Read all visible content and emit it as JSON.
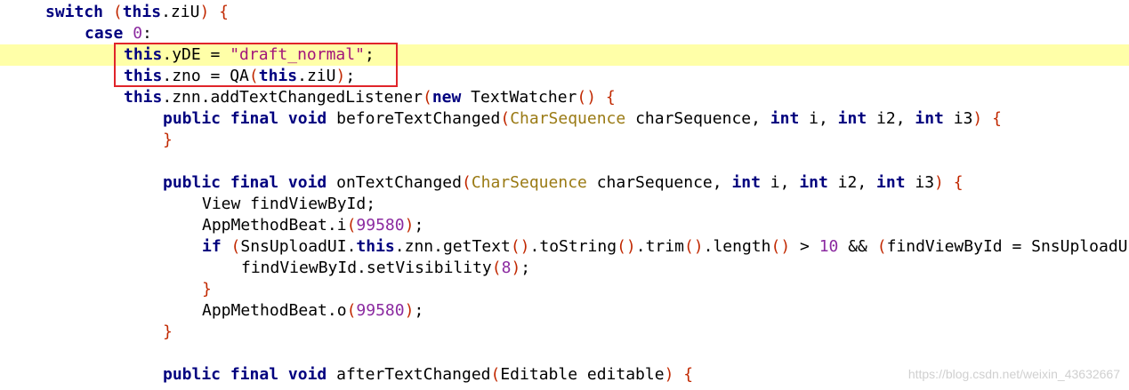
{
  "editor": {
    "current_line": 3,
    "colors": {
      "background": "#ffffff",
      "current_line_background": "#ffffa8",
      "keyword": "#00007f",
      "string": "#a3157a",
      "number": "#8b2aa0",
      "type": "#9a7a14",
      "paren": "#c12800",
      "highlight_box": "#e0242a"
    },
    "lines": [
      {
        "indent": 1,
        "tokens": [
          {
            "t": "switch",
            "k": "kw"
          },
          {
            "t": " ",
            "k": "plain"
          },
          {
            "t": "(",
            "k": "paren"
          },
          {
            "t": "this",
            "k": "kw"
          },
          {
            "t": ".ziU",
            "k": "plain"
          },
          {
            "t": ")",
            "k": "paren"
          },
          {
            "t": " ",
            "k": "plain"
          },
          {
            "t": "{",
            "k": "paren"
          }
        ]
      },
      {
        "indent": 2,
        "tokens": [
          {
            "t": "case",
            "k": "kw"
          },
          {
            "t": " ",
            "k": "plain"
          },
          {
            "t": "0",
            "k": "num"
          },
          {
            "t": ":",
            "k": "plain"
          }
        ]
      },
      {
        "indent": 3,
        "tokens": [
          {
            "t": "this",
            "k": "kw"
          },
          {
            "t": ".yDE = ",
            "k": "plain"
          },
          {
            "t": "\"draft_normal\"",
            "k": "str"
          },
          {
            "t": ";",
            "k": "plain"
          }
        ]
      },
      {
        "indent": 3,
        "tokens": [
          {
            "t": "this",
            "k": "kw"
          },
          {
            "t": ".zno = QA",
            "k": "plain"
          },
          {
            "t": "(",
            "k": "paren"
          },
          {
            "t": "this",
            "k": "kw"
          },
          {
            "t": ".ziU",
            "k": "plain"
          },
          {
            "t": ")",
            "k": "paren"
          },
          {
            "t": ";",
            "k": "plain"
          }
        ]
      },
      {
        "indent": 3,
        "tokens": [
          {
            "t": "this",
            "k": "kw"
          },
          {
            "t": ".znn.addTextChangedListener",
            "k": "plain"
          },
          {
            "t": "(",
            "k": "paren"
          },
          {
            "t": "new",
            "k": "kw"
          },
          {
            "t": " TextWatcher",
            "k": "plain"
          },
          {
            "t": "()",
            "k": "paren"
          },
          {
            "t": " ",
            "k": "plain"
          },
          {
            "t": "{",
            "k": "paren"
          }
        ]
      },
      {
        "indent": 4,
        "tokens": [
          {
            "t": "public",
            "k": "kw"
          },
          {
            "t": " ",
            "k": "plain"
          },
          {
            "t": "final",
            "k": "kw"
          },
          {
            "t": " ",
            "k": "plain"
          },
          {
            "t": "void",
            "k": "kw"
          },
          {
            "t": " beforeTextChanged",
            "k": "plain"
          },
          {
            "t": "(",
            "k": "paren"
          },
          {
            "t": "CharSequence",
            "k": "typ"
          },
          {
            "t": " charSequence, ",
            "k": "plain"
          },
          {
            "t": "int",
            "k": "kw"
          },
          {
            "t": " i, ",
            "k": "plain"
          },
          {
            "t": "int",
            "k": "kw"
          },
          {
            "t": " i2, ",
            "k": "plain"
          },
          {
            "t": "int",
            "k": "kw"
          },
          {
            "t": " i3",
            "k": "plain"
          },
          {
            "t": ")",
            "k": "paren"
          },
          {
            "t": " ",
            "k": "plain"
          },
          {
            "t": "{",
            "k": "paren"
          }
        ]
      },
      {
        "indent": 4,
        "tokens": [
          {
            "t": "}",
            "k": "paren"
          }
        ]
      },
      {
        "indent": 0,
        "tokens": []
      },
      {
        "indent": 4,
        "tokens": [
          {
            "t": "public",
            "k": "kw"
          },
          {
            "t": " ",
            "k": "plain"
          },
          {
            "t": "final",
            "k": "kw"
          },
          {
            "t": " ",
            "k": "plain"
          },
          {
            "t": "void",
            "k": "kw"
          },
          {
            "t": " onTextChanged",
            "k": "plain"
          },
          {
            "t": "(",
            "k": "paren"
          },
          {
            "t": "CharSequence",
            "k": "typ"
          },
          {
            "t": " charSequence, ",
            "k": "plain"
          },
          {
            "t": "int",
            "k": "kw"
          },
          {
            "t": " i, ",
            "k": "plain"
          },
          {
            "t": "int",
            "k": "kw"
          },
          {
            "t": " i2, ",
            "k": "plain"
          },
          {
            "t": "int",
            "k": "kw"
          },
          {
            "t": " i3",
            "k": "plain"
          },
          {
            "t": ")",
            "k": "paren"
          },
          {
            "t": " ",
            "k": "plain"
          },
          {
            "t": "{",
            "k": "paren"
          }
        ]
      },
      {
        "indent": 5,
        "tokens": [
          {
            "t": "View findViewById;",
            "k": "plain"
          }
        ]
      },
      {
        "indent": 5,
        "tokens": [
          {
            "t": "AppMethodBeat.i",
            "k": "plain"
          },
          {
            "t": "(",
            "k": "paren"
          },
          {
            "t": "99580",
            "k": "num"
          },
          {
            "t": ")",
            "k": "paren"
          },
          {
            "t": ";",
            "k": "plain"
          }
        ]
      },
      {
        "indent": 5,
        "tokens": [
          {
            "t": "if",
            "k": "kw"
          },
          {
            "t": " ",
            "k": "plain"
          },
          {
            "t": "(",
            "k": "paren"
          },
          {
            "t": "SnsUploadUI.",
            "k": "plain"
          },
          {
            "t": "this",
            "k": "kw"
          },
          {
            "t": ".znn.getText",
            "k": "plain"
          },
          {
            "t": "()",
            "k": "paren"
          },
          {
            "t": ".toString",
            "k": "plain"
          },
          {
            "t": "()",
            "k": "paren"
          },
          {
            "t": ".trim",
            "k": "plain"
          },
          {
            "t": "()",
            "k": "paren"
          },
          {
            "t": ".length",
            "k": "plain"
          },
          {
            "t": "()",
            "k": "paren"
          },
          {
            "t": " > ",
            "k": "plain"
          },
          {
            "t": "10",
            "k": "num"
          },
          {
            "t": " && ",
            "k": "plain"
          },
          {
            "t": "(",
            "k": "paren"
          },
          {
            "t": "findViewById = SnsUploadU",
            "k": "plain"
          }
        ]
      },
      {
        "indent": 6,
        "tokens": [
          {
            "t": "findViewById.setVisibility",
            "k": "plain"
          },
          {
            "t": "(",
            "k": "paren"
          },
          {
            "t": "8",
            "k": "num"
          },
          {
            "t": ")",
            "k": "paren"
          },
          {
            "t": ";",
            "k": "plain"
          }
        ]
      },
      {
        "indent": 5,
        "tokens": [
          {
            "t": "}",
            "k": "paren"
          }
        ]
      },
      {
        "indent": 5,
        "tokens": [
          {
            "t": "AppMethodBeat.o",
            "k": "plain"
          },
          {
            "t": "(",
            "k": "paren"
          },
          {
            "t": "99580",
            "k": "num"
          },
          {
            "t": ")",
            "k": "paren"
          },
          {
            "t": ";",
            "k": "plain"
          }
        ]
      },
      {
        "indent": 4,
        "tokens": [
          {
            "t": "}",
            "k": "paren"
          }
        ]
      },
      {
        "indent": 0,
        "tokens": []
      },
      {
        "indent": 4,
        "tokens": [
          {
            "t": "public",
            "k": "kw"
          },
          {
            "t": " ",
            "k": "plain"
          },
          {
            "t": "final",
            "k": "kw"
          },
          {
            "t": " ",
            "k": "plain"
          },
          {
            "t": "void",
            "k": "kw"
          },
          {
            "t": " afterTextChanged",
            "k": "plain"
          },
          {
            "t": "(",
            "k": "paren"
          },
          {
            "t": "Editable editable",
            "k": "plain"
          },
          {
            "t": ")",
            "k": "paren"
          },
          {
            "t": " ",
            "k": "plain"
          },
          {
            "t": "{",
            "k": "paren"
          }
        ]
      }
    ]
  },
  "watermark": "https://blog.csdn.net/weixin_43632667"
}
